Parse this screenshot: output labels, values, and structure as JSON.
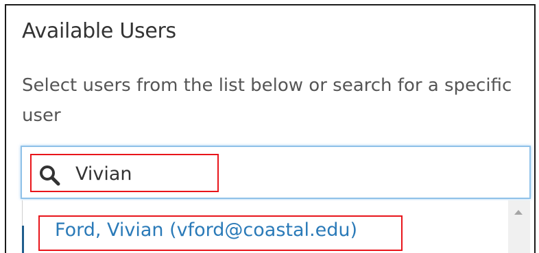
{
  "panel": {
    "title": "Available Users",
    "description": "Select users from the list below or search for a specific user"
  },
  "search": {
    "value": "Vivian",
    "icon": "search-icon"
  },
  "results": [
    {
      "label": "Ford, Vivian (vford@coastal.edu)"
    }
  ],
  "colors": {
    "highlight": "#e8141a",
    "link": "#2a7ab8",
    "focus_border": "#8fc1e8"
  }
}
